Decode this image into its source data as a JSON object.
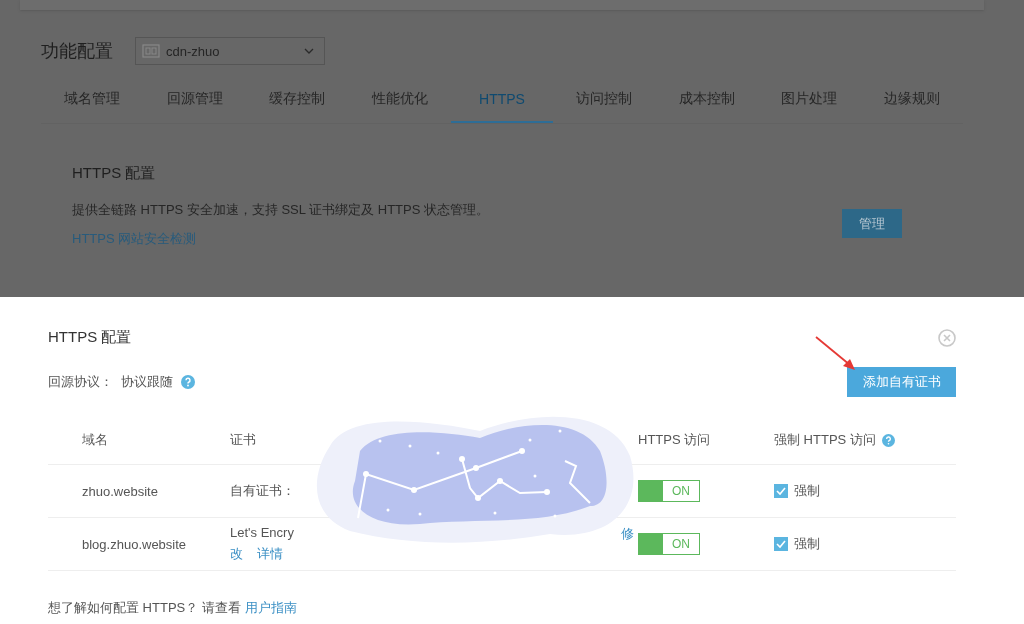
{
  "background_page": {
    "title": "功能配置",
    "selector": {
      "value": "cdn-zhuo"
    },
    "tabs": [
      {
        "label": "域名管理",
        "selected": false
      },
      {
        "label": "回源管理",
        "selected": false
      },
      {
        "label": "缓存控制",
        "selected": false
      },
      {
        "label": "性能优化",
        "selected": false
      },
      {
        "label": "HTTPS",
        "selected": true
      },
      {
        "label": "访问控制",
        "selected": false
      },
      {
        "label": "成本控制",
        "selected": false
      },
      {
        "label": "图片处理",
        "selected": false
      },
      {
        "label": "边缘规则",
        "selected": false
      }
    ],
    "section": {
      "title": "HTTPS 配置",
      "description": "提供全链路 HTTPS 安全加速，支持 SSL 证书绑定及 HTTPS 状态管理。",
      "link": "HTTPS 网站安全检测",
      "button": "管理"
    }
  },
  "dialog": {
    "title": "HTTPS 配置",
    "origin_protocol": {
      "label": "回源协议：",
      "value": "协议跟随",
      "help": true
    },
    "add_button": "添加自有证书",
    "table": {
      "columns": [
        {
          "label": "域名",
          "help": false
        },
        {
          "label": "证书",
          "help": false
        },
        {
          "label": "HTTPS 访问",
          "help": false
        },
        {
          "label": "强制 HTTPS 访问",
          "help": true
        }
      ],
      "rows": [
        {
          "domain": "zhuo.website",
          "certificate": "自有证书：",
          "https_access": {
            "on": true,
            "label": "ON"
          },
          "force": {
            "checked": true,
            "label": "强制"
          }
        },
        {
          "domain": "blog.zhuo.website",
          "certificate": "Let's Encry",
          "edit_link_parts": [
            "修",
            "改"
          ],
          "detail_link": "详情",
          "https_access": {
            "on": true,
            "label": "ON"
          },
          "force": {
            "checked": true,
            "label": "强制"
          }
        }
      ]
    },
    "footer": {
      "text": "想了解如何配置 HTTPS？ 请查看",
      "link": "用户指南"
    }
  }
}
